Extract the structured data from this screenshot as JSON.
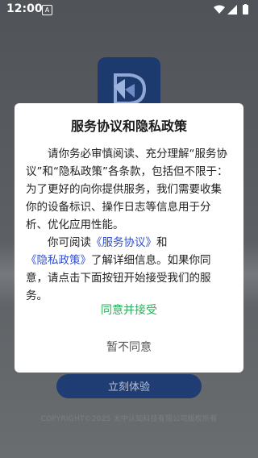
{
  "status_bar": {
    "time": "12:00",
    "notification_icon": "a-icon",
    "wifi_icon": "wifi-icon",
    "signal_icon": "signal-icon",
    "battery_icon": "battery-icon"
  },
  "background": {
    "logo_icon": "app-logo-icon",
    "cta_label": "立刻体验",
    "copyright": "COPYRIGHT©2025 太中认知科技有限公司版权所有"
  },
  "dialog": {
    "title": "服务协议和隐私政策",
    "paragraph1": "请你务必审慎阅读、充分理解“服务协议”和“隐私政策”各条款，包括但不限于：为了更好的向你提供服务，我们需要收集你的设备标识、操作日志等信息用于分析、优化应用性能。",
    "p2_prefix": "你可阅读",
    "p2_link1": "《服务协议》",
    "p2_and": "和",
    "p2_link2": "《隐私政策》",
    "p2_suffix": "了解详细信息。如果你同意，请点击下面按钮开始接受我们的服务。",
    "agree_label": "同意并接受",
    "disagree_label": "暂不同意"
  },
  "colors": {
    "agree": "#27b15a",
    "link": "#2f4ed1",
    "cta": "#1f3d73"
  }
}
